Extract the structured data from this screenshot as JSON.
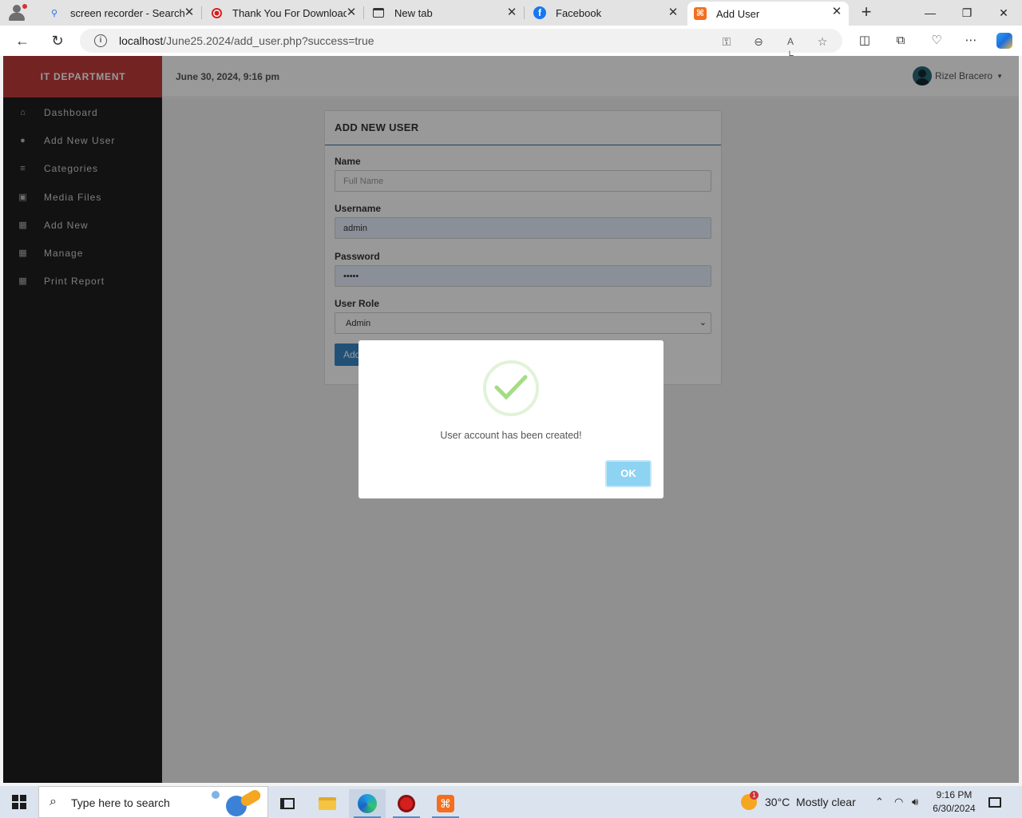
{
  "browser": {
    "tabs": [
      {
        "title": "screen recorder - Search",
        "icon": "search-icon",
        "active": false
      },
      {
        "title": "Thank You For Downloading",
        "icon": "record-icon",
        "active": false
      },
      {
        "title": "New tab",
        "icon": "newtab-icon",
        "active": false
      },
      {
        "title": "Facebook",
        "icon": "facebook-icon",
        "active": false
      },
      {
        "title": "Add User",
        "icon": "xampp-icon",
        "active": true
      }
    ],
    "url_host": "localhost",
    "url_path": "/June25.2024/add_user.php?success=true"
  },
  "app": {
    "brand": "IT DEPARTMENT",
    "datetime": "June 30, 2024, 9:16 pm",
    "user_name": "Rizel Bracero",
    "sidebar": [
      {
        "label": "Dashboard",
        "icon": "home-icon"
      },
      {
        "label": "Add New User",
        "icon": "user-icon"
      },
      {
        "label": "Categories",
        "icon": "categories-icon"
      },
      {
        "label": "Media Files",
        "icon": "image-icon"
      },
      {
        "label": "Add New",
        "icon": "grid-icon"
      },
      {
        "label": "Manage",
        "icon": "grid-icon"
      },
      {
        "label": "Print Report",
        "icon": "grid-icon"
      }
    ],
    "form": {
      "heading": "ADD NEW USER",
      "name_label": "Name",
      "name_placeholder": "Full Name",
      "username_label": "Username",
      "username_value": "admin",
      "password_label": "Password",
      "password_value": "•••••",
      "role_label": "User Role",
      "role_value": "Admin",
      "submit_label": "Add User"
    },
    "modal": {
      "message": "User account has been created!",
      "ok_label": "OK",
      "icon": "success-check-icon"
    }
  },
  "taskbar": {
    "search_placeholder": "Type here to search",
    "weather": "30°C  Mostly clear",
    "weather_badge": "1",
    "time": "9:16 PM",
    "date": "6/30/2024"
  },
  "colors": {
    "brand": "#c13b3b",
    "sidebar": "#1f1f1f",
    "accent": "#3a87c8",
    "ok_button": "#8ed3f2",
    "success": "#a5dc86"
  }
}
